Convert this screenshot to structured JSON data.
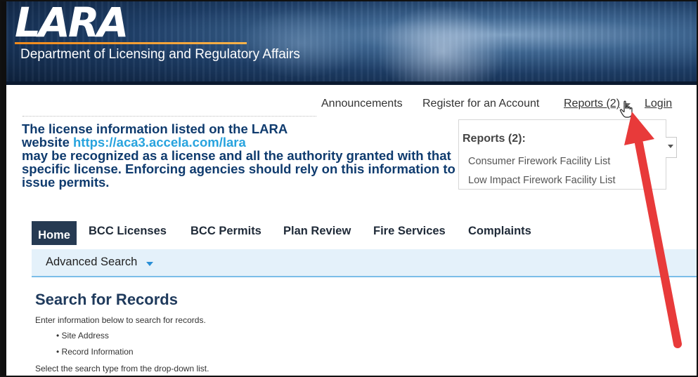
{
  "header": {
    "logo_text": "LARA",
    "department": "Department of Licensing and Regulatory Affairs"
  },
  "toplinks": {
    "announcements": "Announcements",
    "register": "Register for an Account",
    "reports": "Reports (2)",
    "login": "Login"
  },
  "notice": {
    "line1": "The license information listed on the LARA",
    "website_prefix": "website ",
    "url": "https://aca3.accela.com/lara",
    "rest": "may be recognized as a license and all the authority granted with that specific license. Enforcing agencies should rely on this information to issue permits."
  },
  "reports_menu": {
    "heading": "Reports (2):",
    "items": [
      "Consumer Firework Facility List",
      "Low Impact Firework Facility List"
    ]
  },
  "mainnav": {
    "items": [
      "Home",
      "BCC Licenses",
      "BCC Permits",
      "Plan Review",
      "Fire Services",
      "Complaints"
    ]
  },
  "subnav": {
    "advanced_search": "Advanced Search"
  },
  "search": {
    "title": "Search for Records",
    "intro": "Enter information below to search for records.",
    "bullets": [
      "• Site Address",
      "• Record Information"
    ],
    "select_text": "Select the search type from the drop-down list."
  },
  "colors": {
    "notice_text": "#0f3b6e",
    "link": "#27a3de",
    "nav_active": "#263a52",
    "annotation_arrow": "#e83a3a"
  },
  "icons": [
    "hand-cursor-icon",
    "chevron-down-icon",
    "annotation-arrow"
  ]
}
